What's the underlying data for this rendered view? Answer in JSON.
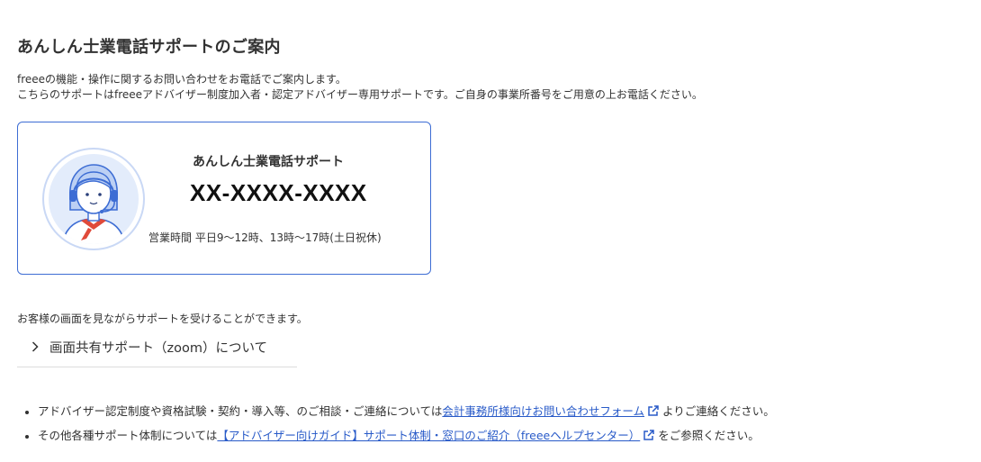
{
  "page": {
    "title": "あんしん士業電話サポートのご案内",
    "intro_line1": "freeeの機能・操作に関するお問い合わせをお電話でご案内します。",
    "intro_line2": "こちらのサポートはfreeeアドバイザー制度加入者・認定アドバイザー専用サポートです。ご自身の事業所番号をご用意の上お電話ください。"
  },
  "card": {
    "name": "あんしん士業電話サポート",
    "phone": "XX-XXXX-XXXX",
    "hours": "営業時間 平日9〜12時、13時〜17時(土日祝休)",
    "avatar_icon": "support-operator-illustration"
  },
  "screen_share": {
    "description": "お客様の画面を見ながらサポートを受けることができます。",
    "accordion_label": "画面共有サポート（zoom）について",
    "accordion_icon": "chevron-right-icon"
  },
  "notes": {
    "item1_prefix": "アドバイザー認定制度や資格試験・契約・導入等、のご相談・ご連絡については",
    "item1_link": "会計事務所様向けお問い合わせフォーム",
    "item1_suffix": "よりご連絡ください。",
    "item2_prefix": "その他各種サポート体制については",
    "item2_link": "【アドバイザー向けガイド】サポート体制・窓口のご紹介（freeeヘルプセンター）",
    "item2_suffix": "をご参照ください。",
    "link_icon": "external-link-icon"
  },
  "colors": {
    "accent": "#3d6dd4",
    "link": "#285ac8",
    "text": "#323232"
  }
}
